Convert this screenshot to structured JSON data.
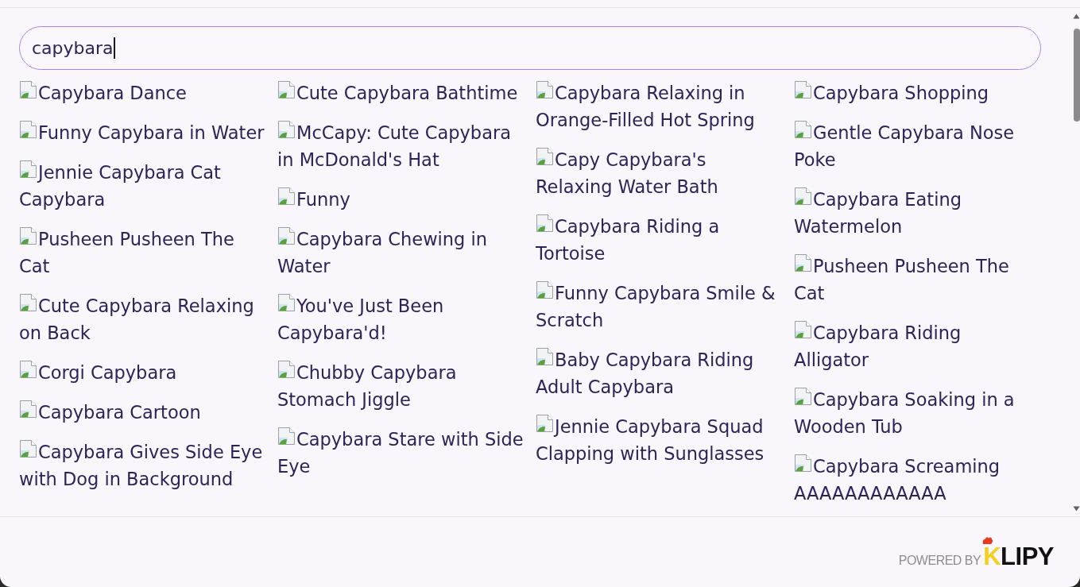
{
  "search": {
    "value": "capybara",
    "focused": true
  },
  "result_columns": [
    {
      "items": [
        {
          "title": "Capybara Dance"
        },
        {
          "title": "Funny Capybara in Water"
        },
        {
          "title": "Jennie Capybara Cat Capybara"
        },
        {
          "title": "Pusheen Pusheen The Cat"
        },
        {
          "title": "Cute Capybara Relaxing on Back"
        },
        {
          "title": "Corgi Capybara"
        },
        {
          "title": "Capybara Cartoon"
        },
        {
          "title": "Capybara Gives Side Eye with Dog in Background"
        }
      ]
    },
    {
      "items": [
        {
          "title": "Cute Capybara Bathtime"
        },
        {
          "title": "McCapy: Cute Capybara in McDonald's Hat"
        },
        {
          "title": "Funny"
        },
        {
          "title": "Capybara Chewing in Water"
        },
        {
          "title": "You've Just Been Capybara'd!"
        },
        {
          "title": "Chubby Capybara Stomach Jiggle"
        },
        {
          "title": "Capybara Stare with Side Eye"
        }
      ]
    },
    {
      "items": [
        {
          "title": "Capybara Relaxing in Orange-Filled Hot Spring"
        },
        {
          "title": "Capy Capybara's Relaxing Water Bath"
        },
        {
          "title": "Capybara Riding a Tortoise"
        },
        {
          "title": "Funny Capybara Smile & Scratch"
        },
        {
          "title": "Baby Capybara Riding Adult Capybara"
        },
        {
          "title": "Jennie Capybara Squad Clapping with Sunglasses"
        }
      ]
    },
    {
      "items": [
        {
          "title": "Capybara Shopping"
        },
        {
          "title": "Gentle Capybara Nose Poke"
        },
        {
          "title": "Capybara Eating Watermelon"
        },
        {
          "title": "Pusheen Pusheen The Cat"
        },
        {
          "title": "Capybara Riding Alligator"
        },
        {
          "title": "Capybara Soaking in a Wooden Tub"
        },
        {
          "title": "Capybara Screaming AAAAAAAAAAAA"
        }
      ]
    }
  ],
  "footer": {
    "powered_by": "POWERED BY",
    "brand": "KLIPY"
  }
}
